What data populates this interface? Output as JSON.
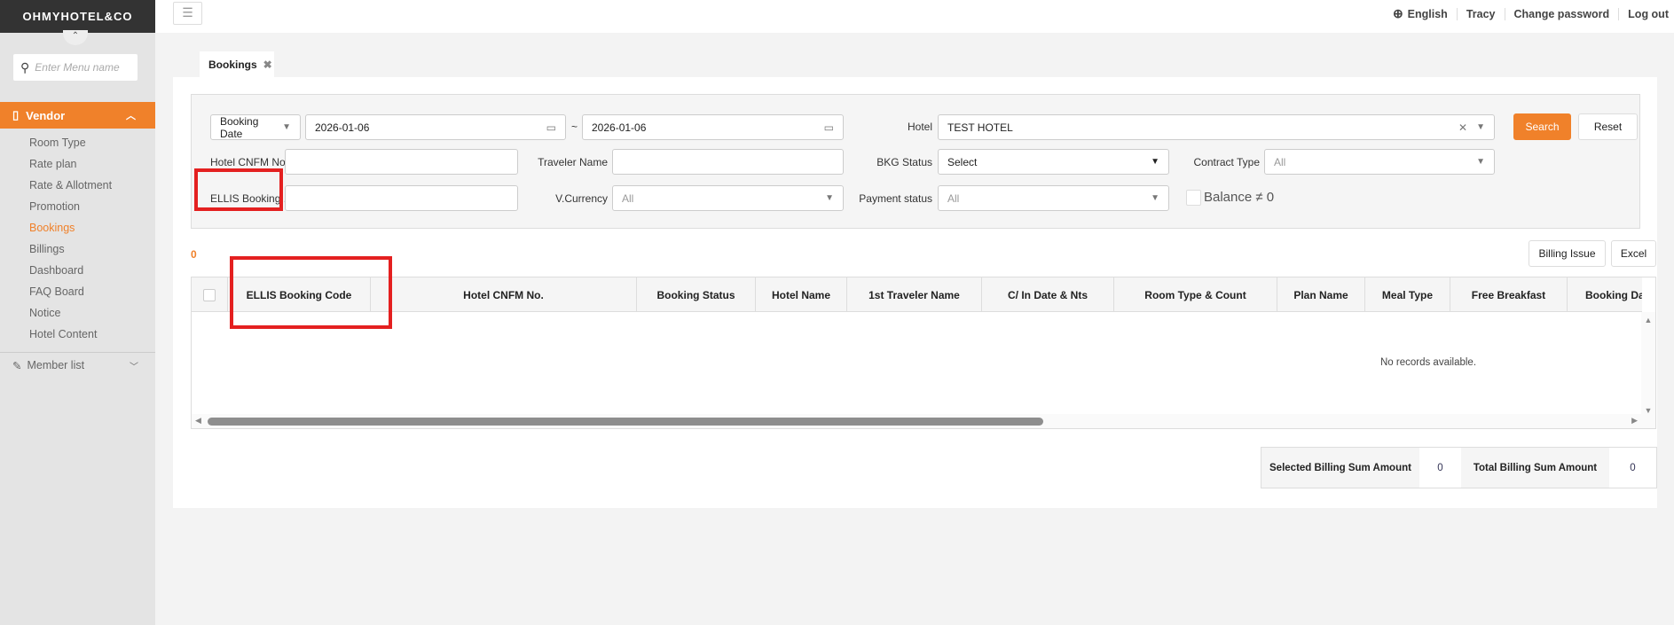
{
  "brand": {
    "logo": "OHMYHOTEL&CO"
  },
  "sidebar": {
    "search_placeholder": "Enter Menu name",
    "group": "Vendor",
    "items": [
      {
        "label": "Room Type"
      },
      {
        "label": "Rate plan"
      },
      {
        "label": "Rate & Allotment"
      },
      {
        "label": "Promotion"
      },
      {
        "label": "Bookings",
        "active": true
      },
      {
        "label": "Billings"
      },
      {
        "label": "Dashboard"
      },
      {
        "label": "FAQ Board"
      },
      {
        "label": "Notice"
      },
      {
        "label": "Hotel Content"
      }
    ],
    "member_list": "Member list"
  },
  "topbar": {
    "language": "English",
    "user": "Tracy",
    "change_password": "Change password",
    "logout": "Log out"
  },
  "tab": {
    "label": "Bookings"
  },
  "filter": {
    "date_type": "Booking Date",
    "date_from": "2026-01-06",
    "date_sep": "~",
    "date_to": "2026-01-06",
    "hotel_label": "Hotel",
    "hotel_value": "TEST HOTEL",
    "search": "Search",
    "reset": "Reset",
    "hotel_cnfm_label": "Hotel CNFM No.",
    "traveler_label": "Traveler Name",
    "bkg_status_label": "BKG Status",
    "bkg_status_value": "Select",
    "contract_type_label": "Contract Type",
    "contract_type_value": "All",
    "ellis_label": "ELLIS Booking...",
    "vcurrency_label": "V.Currency",
    "vcurrency_value": "All",
    "payment_label": "Payment status",
    "payment_value": "All",
    "balance_label": "Balance ≠ 0"
  },
  "results": {
    "count": "0",
    "billing_issue": "Billing Issue",
    "excel": "Excel",
    "no_records": "No records available."
  },
  "table": {
    "columns": [
      "ELLIS Booking Code",
      "Hotel CNFM No.",
      "Booking Status",
      "Hotel Name",
      "1st Traveler Name",
      "C/ In Date & Nts",
      "Room Type & Count",
      "Plan Name",
      "Meal Type",
      "Free Breakfast",
      "Booking Da"
    ]
  },
  "summary": {
    "selected_label": "Selected Billing Sum Amount",
    "selected_value": "0",
    "total_label": "Total Billing Sum Amount",
    "total_value": "0"
  },
  "colors": {
    "accent": "#f0812a",
    "highlight": "#e42020"
  }
}
